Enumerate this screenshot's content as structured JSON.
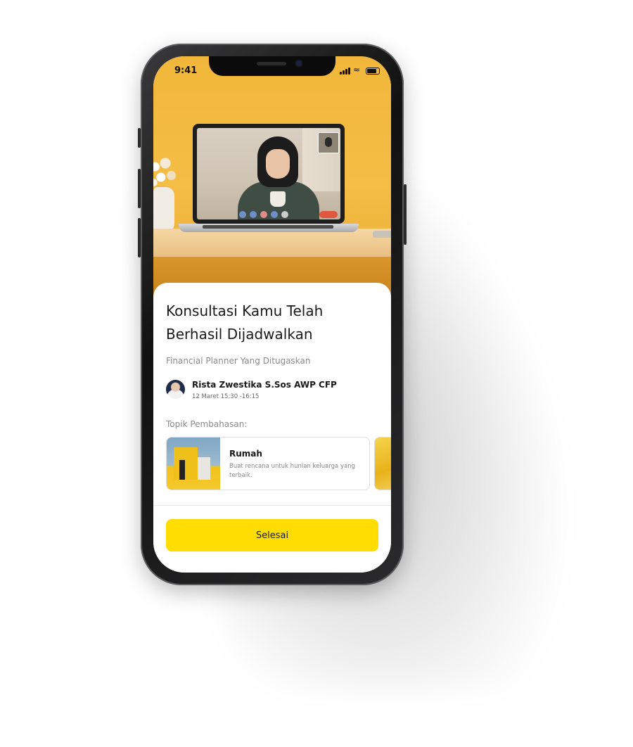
{
  "status_bar": {
    "time": "9:41"
  },
  "sheet": {
    "title_line1": "Konsultasi Kamu Telah",
    "title_line2": "Berhasil Dijadwalkan",
    "subtitle": "Financial Planner Yang Ditugaskan",
    "planner": {
      "name": "Rista Zwestika S.Sos AWP CFP",
      "schedule": "12 Maret 15:30 -16:15"
    },
    "topics_label": "Topik Pembahasan:",
    "topics": [
      {
        "title": "Rumah",
        "description": "Buat rencana untuk hunian keluarga yang terbaik."
      }
    ]
  },
  "cta": {
    "label": "Selesai"
  },
  "colors": {
    "accent": "#ffdd00",
    "hero_background": "#f2b73a"
  }
}
